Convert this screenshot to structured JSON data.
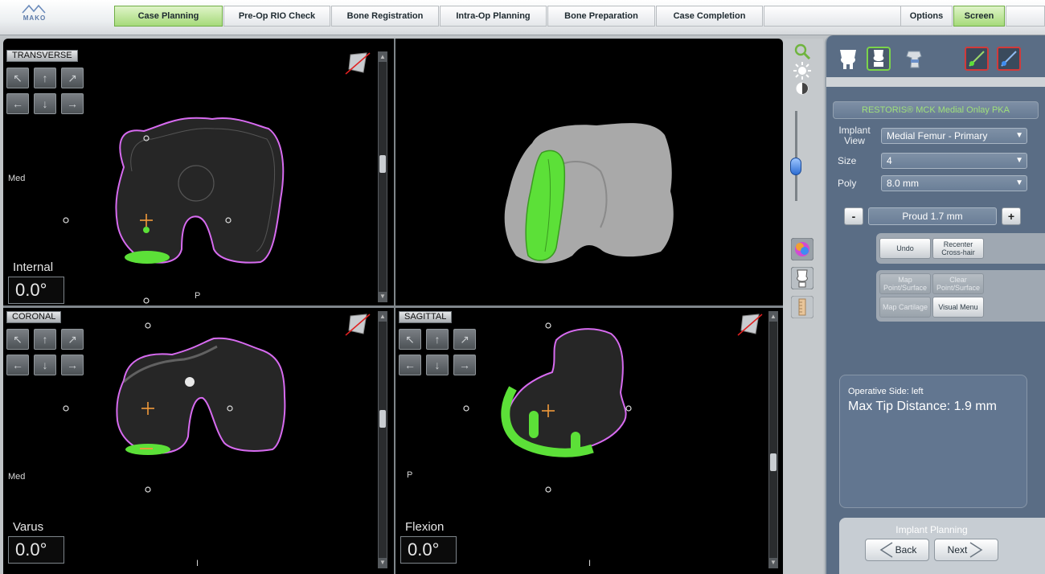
{
  "logo": {
    "text": "MAKO"
  },
  "workflow_tabs": [
    {
      "label": "Case Planning",
      "active": true
    },
    {
      "label": "Pre-Op RIO Check",
      "active": false
    },
    {
      "label": "Bone Registration",
      "active": false
    },
    {
      "label": "Intra-Op Planning",
      "active": false
    },
    {
      "label": "Bone Preparation",
      "active": false
    },
    {
      "label": "Case Completion",
      "active": false
    }
  ],
  "top_right": {
    "options_label": "Options",
    "screen_label": "Screen"
  },
  "views": {
    "transverse": {
      "title": "TRANSVERSE",
      "angle_label": "Internal",
      "angle_value": "0.0°",
      "side_label": "Med",
      "bottom_marker": "P"
    },
    "coronal": {
      "title": "CORONAL",
      "angle_label": "Varus",
      "angle_value": "0.0°",
      "side_label": "Med",
      "bottom_marker": "I"
    },
    "sagittal": {
      "title": "SAGITTAL",
      "angle_label": "Flexion",
      "angle_value": "0.0°",
      "side_label": "P",
      "bottom_marker": "I"
    }
  },
  "pan_arrows": [
    "↖",
    "↑",
    "↗",
    "←",
    "↓",
    "→"
  ],
  "panel": {
    "implant_title": "RESTORIS® MCK Medial Onlay PKA",
    "implant_view_label": "Implant View",
    "implant_view_value": "Medial Femur - Primary",
    "size_label": "Size",
    "size_value": "4",
    "poly_label": "Poly",
    "poly_value": "8.0 mm",
    "minus_label": "-",
    "plus_label": "+",
    "proud_value": "Proud 1.7 mm",
    "undo_label": "Undo",
    "recenter_label": "Recenter Cross-hair",
    "map_point_label": "Map Point/Surface",
    "clear_point_label": "Clear Point/Surface",
    "map_cartilage_label": "Map Cartilage",
    "visual_menu_label": "Visual Menu",
    "operative_side": "Operative Side: left",
    "max_tip_distance": "Max Tip Distance: 1.9 mm",
    "nav_title": "Implant Planning",
    "back_label": "Back",
    "next_label": "Next"
  },
  "colors": {
    "implant_green": "#5ce038",
    "bone_outline": "#d76bf0",
    "active_tab": "#a6da7a",
    "panel_bg": "#5a6d85"
  }
}
